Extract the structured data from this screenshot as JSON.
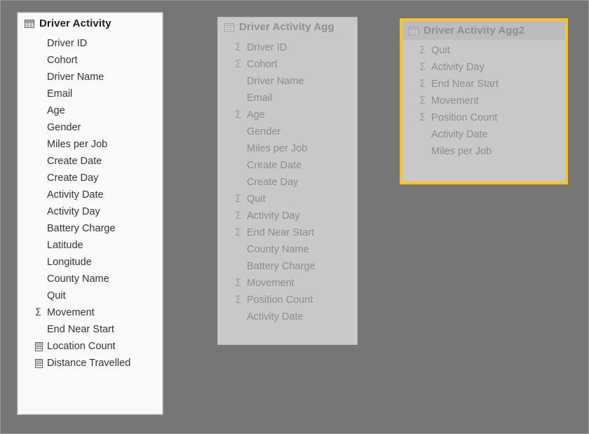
{
  "canvas": {
    "background_color": "#767676",
    "frame_border_color": "#9a9a9a"
  },
  "colors": {
    "selection_outline": "#f7c325",
    "active_panel_background": "#fafafa",
    "dimmed_panel_background": "#c9c9c9",
    "active_text": "#1d1d1d",
    "dimmed_text": "#8b8b8b"
  },
  "panels": [
    {
      "id": "driver-activity",
      "title": "Driver Activity",
      "icon": "table-icon",
      "state": "active",
      "selected": false,
      "fields": [
        {
          "label": "Driver ID",
          "icon": "none"
        },
        {
          "label": "Cohort",
          "icon": "none"
        },
        {
          "label": "Driver Name",
          "icon": "none"
        },
        {
          "label": "Email",
          "icon": "none"
        },
        {
          "label": "Age",
          "icon": "none"
        },
        {
          "label": "Gender",
          "icon": "none"
        },
        {
          "label": "Miles per Job",
          "icon": "none"
        },
        {
          "label": "Create Date",
          "icon": "none"
        },
        {
          "label": "Create Day",
          "icon": "none"
        },
        {
          "label": "Activity Date",
          "icon": "none"
        },
        {
          "label": "Activity Day",
          "icon": "none"
        },
        {
          "label": "Battery Charge",
          "icon": "none"
        },
        {
          "label": "Latitude",
          "icon": "none"
        },
        {
          "label": "Longitude",
          "icon": "none"
        },
        {
          "label": "County Name",
          "icon": "none"
        },
        {
          "label": "Quit",
          "icon": "none"
        },
        {
          "label": "Movement",
          "icon": "sigma-icon"
        },
        {
          "label": "End Near Start",
          "icon": "none"
        },
        {
          "label": "Location Count",
          "icon": "calculator-icon"
        },
        {
          "label": "Distance Travelled",
          "icon": "calculator-icon"
        }
      ]
    },
    {
      "id": "driver-activity-agg",
      "title": "Driver Activity Agg",
      "icon": "table-icon",
      "state": "dimmed",
      "selected": false,
      "fields": [
        {
          "label": "Driver ID",
          "icon": "sigma-icon"
        },
        {
          "label": "Cohort",
          "icon": "sigma-icon"
        },
        {
          "label": "Driver Name",
          "icon": "none"
        },
        {
          "label": "Email",
          "icon": "none"
        },
        {
          "label": "Age",
          "icon": "sigma-icon"
        },
        {
          "label": "Gender",
          "icon": "none"
        },
        {
          "label": "Miles per Job",
          "icon": "none"
        },
        {
          "label": "Create Date",
          "icon": "none"
        },
        {
          "label": "Create Day",
          "icon": "none"
        },
        {
          "label": "Quit",
          "icon": "sigma-icon"
        },
        {
          "label": "Activity Day",
          "icon": "sigma-icon"
        },
        {
          "label": "End Near Start",
          "icon": "sigma-icon"
        },
        {
          "label": "County Name",
          "icon": "none"
        },
        {
          "label": "Battery Charge",
          "icon": "none"
        },
        {
          "label": "Movement",
          "icon": "sigma-icon"
        },
        {
          "label": "Position Count",
          "icon": "sigma-icon"
        },
        {
          "label": "Activity Date",
          "icon": "none"
        }
      ]
    },
    {
      "id": "driver-activity-agg2",
      "title": "Driver Activity Agg2",
      "icon": "table-icon",
      "state": "dimmed",
      "selected": true,
      "fields": [
        {
          "label": "Quit",
          "icon": "sigma-icon"
        },
        {
          "label": "Activity Day",
          "icon": "sigma-icon"
        },
        {
          "label": "End Near Start",
          "icon": "sigma-icon"
        },
        {
          "label": "Movement",
          "icon": "sigma-icon"
        },
        {
          "label": "Position Count",
          "icon": "sigma-icon"
        },
        {
          "label": "Activity Date",
          "icon": "none"
        },
        {
          "label": "Miles per Job",
          "icon": "none"
        }
      ]
    }
  ]
}
